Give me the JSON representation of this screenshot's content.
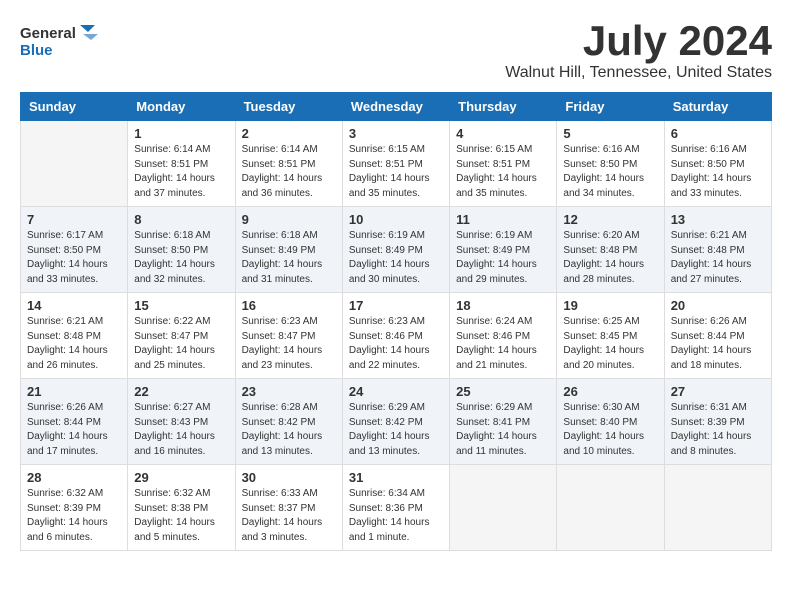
{
  "header": {
    "logo_general": "General",
    "logo_blue": "Blue",
    "month_year": "July 2024",
    "location": "Walnut Hill, Tennessee, United States"
  },
  "weekdays": [
    "Sunday",
    "Monday",
    "Tuesday",
    "Wednesday",
    "Thursday",
    "Friday",
    "Saturday"
  ],
  "weeks": [
    [
      {
        "day": "",
        "sunrise": "",
        "sunset": "",
        "daylight": ""
      },
      {
        "day": "1",
        "sunrise": "Sunrise: 6:14 AM",
        "sunset": "Sunset: 8:51 PM",
        "daylight": "Daylight: 14 hours and 37 minutes."
      },
      {
        "day": "2",
        "sunrise": "Sunrise: 6:14 AM",
        "sunset": "Sunset: 8:51 PM",
        "daylight": "Daylight: 14 hours and 36 minutes."
      },
      {
        "day": "3",
        "sunrise": "Sunrise: 6:15 AM",
        "sunset": "Sunset: 8:51 PM",
        "daylight": "Daylight: 14 hours and 35 minutes."
      },
      {
        "day": "4",
        "sunrise": "Sunrise: 6:15 AM",
        "sunset": "Sunset: 8:51 PM",
        "daylight": "Daylight: 14 hours and 35 minutes."
      },
      {
        "day": "5",
        "sunrise": "Sunrise: 6:16 AM",
        "sunset": "Sunset: 8:50 PM",
        "daylight": "Daylight: 14 hours and 34 minutes."
      },
      {
        "day": "6",
        "sunrise": "Sunrise: 6:16 AM",
        "sunset": "Sunset: 8:50 PM",
        "daylight": "Daylight: 14 hours and 33 minutes."
      }
    ],
    [
      {
        "day": "7",
        "sunrise": "Sunrise: 6:17 AM",
        "sunset": "Sunset: 8:50 PM",
        "daylight": "Daylight: 14 hours and 33 minutes."
      },
      {
        "day": "8",
        "sunrise": "Sunrise: 6:18 AM",
        "sunset": "Sunset: 8:50 PM",
        "daylight": "Daylight: 14 hours and 32 minutes."
      },
      {
        "day": "9",
        "sunrise": "Sunrise: 6:18 AM",
        "sunset": "Sunset: 8:49 PM",
        "daylight": "Daylight: 14 hours and 31 minutes."
      },
      {
        "day": "10",
        "sunrise": "Sunrise: 6:19 AM",
        "sunset": "Sunset: 8:49 PM",
        "daylight": "Daylight: 14 hours and 30 minutes."
      },
      {
        "day": "11",
        "sunrise": "Sunrise: 6:19 AM",
        "sunset": "Sunset: 8:49 PM",
        "daylight": "Daylight: 14 hours and 29 minutes."
      },
      {
        "day": "12",
        "sunrise": "Sunrise: 6:20 AM",
        "sunset": "Sunset: 8:48 PM",
        "daylight": "Daylight: 14 hours and 28 minutes."
      },
      {
        "day": "13",
        "sunrise": "Sunrise: 6:21 AM",
        "sunset": "Sunset: 8:48 PM",
        "daylight": "Daylight: 14 hours and 27 minutes."
      }
    ],
    [
      {
        "day": "14",
        "sunrise": "Sunrise: 6:21 AM",
        "sunset": "Sunset: 8:48 PM",
        "daylight": "Daylight: 14 hours and 26 minutes."
      },
      {
        "day": "15",
        "sunrise": "Sunrise: 6:22 AM",
        "sunset": "Sunset: 8:47 PM",
        "daylight": "Daylight: 14 hours and 25 minutes."
      },
      {
        "day": "16",
        "sunrise": "Sunrise: 6:23 AM",
        "sunset": "Sunset: 8:47 PM",
        "daylight": "Daylight: 14 hours and 23 minutes."
      },
      {
        "day": "17",
        "sunrise": "Sunrise: 6:23 AM",
        "sunset": "Sunset: 8:46 PM",
        "daylight": "Daylight: 14 hours and 22 minutes."
      },
      {
        "day": "18",
        "sunrise": "Sunrise: 6:24 AM",
        "sunset": "Sunset: 8:46 PM",
        "daylight": "Daylight: 14 hours and 21 minutes."
      },
      {
        "day": "19",
        "sunrise": "Sunrise: 6:25 AM",
        "sunset": "Sunset: 8:45 PM",
        "daylight": "Daylight: 14 hours and 20 minutes."
      },
      {
        "day": "20",
        "sunrise": "Sunrise: 6:26 AM",
        "sunset": "Sunset: 8:44 PM",
        "daylight": "Daylight: 14 hours and 18 minutes."
      }
    ],
    [
      {
        "day": "21",
        "sunrise": "Sunrise: 6:26 AM",
        "sunset": "Sunset: 8:44 PM",
        "daylight": "Daylight: 14 hours and 17 minutes."
      },
      {
        "day": "22",
        "sunrise": "Sunrise: 6:27 AM",
        "sunset": "Sunset: 8:43 PM",
        "daylight": "Daylight: 14 hours and 16 minutes."
      },
      {
        "day": "23",
        "sunrise": "Sunrise: 6:28 AM",
        "sunset": "Sunset: 8:42 PM",
        "daylight": "Daylight: 14 hours and 13 minutes."
      },
      {
        "day": "24",
        "sunrise": "Sunrise: 6:29 AM",
        "sunset": "Sunset: 8:42 PM",
        "daylight": "Daylight: 14 hours and 13 minutes."
      },
      {
        "day": "25",
        "sunrise": "Sunrise: 6:29 AM",
        "sunset": "Sunset: 8:41 PM",
        "daylight": "Daylight: 14 hours and 11 minutes."
      },
      {
        "day": "26",
        "sunrise": "Sunrise: 6:30 AM",
        "sunset": "Sunset: 8:40 PM",
        "daylight": "Daylight: 14 hours and 10 minutes."
      },
      {
        "day": "27",
        "sunrise": "Sunrise: 6:31 AM",
        "sunset": "Sunset: 8:39 PM",
        "daylight": "Daylight: 14 hours and 8 minutes."
      }
    ],
    [
      {
        "day": "28",
        "sunrise": "Sunrise: 6:32 AM",
        "sunset": "Sunset: 8:39 PM",
        "daylight": "Daylight: 14 hours and 6 minutes."
      },
      {
        "day": "29",
        "sunrise": "Sunrise: 6:32 AM",
        "sunset": "Sunset: 8:38 PM",
        "daylight": "Daylight: 14 hours and 5 minutes."
      },
      {
        "day": "30",
        "sunrise": "Sunrise: 6:33 AM",
        "sunset": "Sunset: 8:37 PM",
        "daylight": "Daylight: 14 hours and 3 minutes."
      },
      {
        "day": "31",
        "sunrise": "Sunrise: 6:34 AM",
        "sunset": "Sunset: 8:36 PM",
        "daylight": "Daylight: 14 hours and 1 minute."
      },
      {
        "day": "",
        "sunrise": "",
        "sunset": "",
        "daylight": ""
      },
      {
        "day": "",
        "sunrise": "",
        "sunset": "",
        "daylight": ""
      },
      {
        "day": "",
        "sunrise": "",
        "sunset": "",
        "daylight": ""
      }
    ]
  ]
}
